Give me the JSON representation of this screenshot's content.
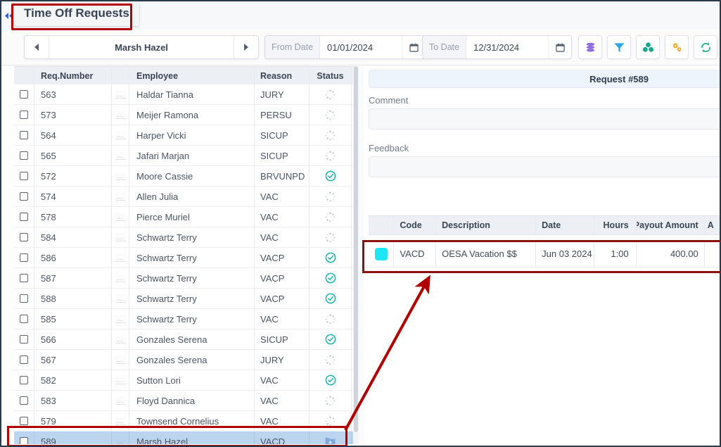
{
  "window": {
    "title": "Time Off Requests",
    "collapse_icon": "double-left-chevron"
  },
  "toolbar": {
    "prev_label": "◄",
    "next_label": "►",
    "employee_name": "Marsh Hazel",
    "from_date_label": "From Date",
    "from_date_value": "01/01/2024",
    "to_date_label": "To Date",
    "to_date_value": "12/31/2024",
    "icons": [
      {
        "name": "database-stack-icon",
        "color": "#8b6ddb"
      },
      {
        "name": "filter-funnel-icon",
        "color": "#2ba5f0"
      },
      {
        "name": "clover-group-icon",
        "color": "#17a88b"
      },
      {
        "name": "settings-gears-icon",
        "color": "#f5a623"
      },
      {
        "name": "refresh-sync-icon",
        "color": "#28b48a"
      }
    ]
  },
  "requests_grid": {
    "columns": [
      "Req.Number",
      "Employee",
      "Reason",
      "Status"
    ],
    "row_menu_label": "...",
    "rows": [
      {
        "num": "563",
        "employee": "Haldar Tianna",
        "reason": "JURY",
        "status": "pending"
      },
      {
        "num": "573",
        "employee": "Meijer Ramona",
        "reason": "PERSU",
        "status": "pending"
      },
      {
        "num": "564",
        "employee": "Harper Vicki",
        "reason": "SICUP",
        "status": "pending"
      },
      {
        "num": "565",
        "employee": "Jafari Marjan",
        "reason": "SICUP",
        "status": "pending"
      },
      {
        "num": "572",
        "employee": "Moore Cassie",
        "reason": "BRVUNPD",
        "status": "approved"
      },
      {
        "num": "574",
        "employee": "Allen Julia",
        "reason": "VAC",
        "status": "pending"
      },
      {
        "num": "578",
        "employee": "Pierce Muriel",
        "reason": "VAC",
        "status": "pending"
      },
      {
        "num": "584",
        "employee": "Schwartz Terry",
        "reason": "VAC",
        "status": "pending"
      },
      {
        "num": "586",
        "employee": "Schwartz Terry",
        "reason": "VACP",
        "status": "approved"
      },
      {
        "num": "587",
        "employee": "Schwartz Terry",
        "reason": "VACP",
        "status": "approved"
      },
      {
        "num": "588",
        "employee": "Schwartz Terry",
        "reason": "VACP",
        "status": "approved"
      },
      {
        "num": "585",
        "employee": "Schwartz Terry",
        "reason": "VAC",
        "status": "pending"
      },
      {
        "num": "566",
        "employee": "Gonzales Serena",
        "reason": "SICUP",
        "status": "approved"
      },
      {
        "num": "567",
        "employee": "Gonzales Serena",
        "reason": "JURY",
        "status": "pending"
      },
      {
        "num": "582",
        "employee": "Sutton Lori",
        "reason": "VAC",
        "status": "approved"
      },
      {
        "num": "583",
        "employee": "Floyd Dannica",
        "reason": "VAC",
        "status": "pending"
      },
      {
        "num": "579",
        "employee": "Townsend Cornelius",
        "reason": "VAC",
        "status": "pending"
      },
      {
        "num": "589",
        "employee": "Marsh Hazel",
        "reason": "VACD",
        "status": "folder",
        "selected": true
      }
    ]
  },
  "detail_panel": {
    "request_header": "Request #589",
    "comment_label": "Comment",
    "comment_value": "",
    "feedback_label": "Feedback",
    "feedback_value": "",
    "table": {
      "columns": [
        "Code",
        "Description",
        "Date",
        "Hours",
        "Payout Amount",
        "A"
      ],
      "rows": [
        {
          "swatch_color": "#1fe6f5",
          "code": "VACD",
          "description": "OESA Vacation $$",
          "date": "Jun 03 2024",
          "hours": "1:00",
          "payout": "400.00",
          "a": ""
        }
      ]
    }
  },
  "annotations": {
    "title_box_color": "#b00000",
    "selected_row_box_color": "#b00000",
    "detail_row_box_color": "#8d1010",
    "arrow_color": "#b00000"
  }
}
